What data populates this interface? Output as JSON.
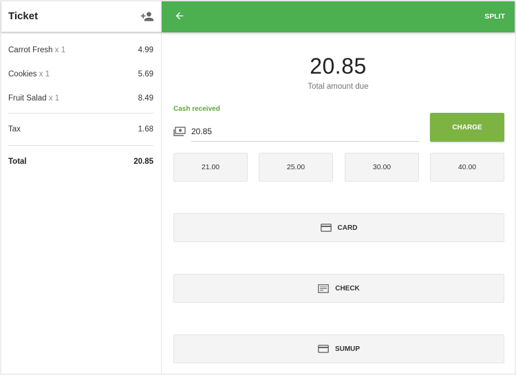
{
  "ticket": {
    "title": "Ticket",
    "add_customer_icon": "person-add-icon",
    "items": [
      {
        "name": "Carrot Fresh",
        "qty": "x 1",
        "price": "4.99"
      },
      {
        "name": "Cookies",
        "qty": "x 1",
        "price": "5.69"
      },
      {
        "name": "Fruit Salad",
        "qty": "x 1",
        "price": "8.49"
      }
    ],
    "tax": {
      "label": "Tax",
      "value": "1.68"
    },
    "total": {
      "label": "Total",
      "value": "20.85"
    }
  },
  "appbar": {
    "back_icon": "arrow-back-icon",
    "split_label": "SPLIT",
    "color": "#4caf50"
  },
  "payment": {
    "amount_due": "20.85",
    "amount_due_label": "Total amount due",
    "cash_label": "Cash received",
    "cash_icon": "cash-icon",
    "cash_value": "20.85",
    "charge_label": "CHARGE",
    "charge_color": "#7cb342",
    "quick_amounts": [
      "21.00",
      "25.00",
      "30.00",
      "40.00"
    ],
    "methods": [
      {
        "label": "CARD",
        "icon": "credit-card-icon"
      },
      {
        "label": "CHECK",
        "icon": "check-icon"
      },
      {
        "label": "SUMUP",
        "icon": "credit-card-icon"
      }
    ]
  }
}
